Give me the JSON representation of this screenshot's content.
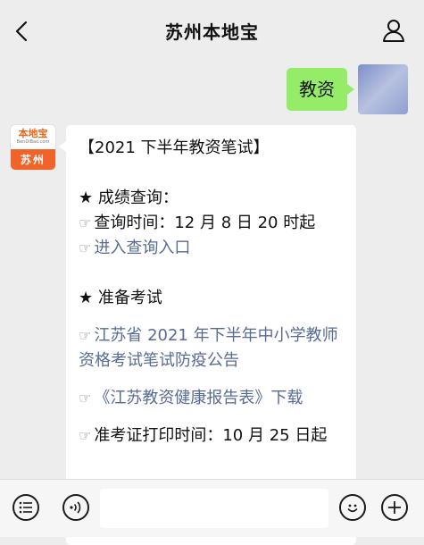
{
  "header": {
    "title": "苏州本地宝"
  },
  "messages": {
    "outgoing": {
      "text": "教资"
    },
    "incoming": {
      "logo_name": "本地宝",
      "logo_sub": "BenDiBao.com",
      "logo_city": "苏州",
      "lines": {
        "heading": "【2021 下半年教资笔试】",
        "score_title": "★ 成绩查询：",
        "query_time": "查询时间：12 月 8 日 20 时起",
        "query_link": "进入查询入口",
        "prep_title": "★ 准备考试",
        "notice_link": "江苏省 2021 年下半年中小学教师资格考试笔试防疫公告",
        "health_link": "《江苏教资健康报告表》下载",
        "admit_time": "准考证打印时间：10 月 25 日起"
      },
      "bullet_icon": "pointing-hand-icon",
      "hand_glyph": "☞"
    }
  },
  "input_bar": {
    "icons": [
      "list-icon",
      "voice-icon",
      "emoji-icon",
      "plus-icon"
    ],
    "placeholder": ""
  },
  "colors": {
    "background": "#ededed",
    "outgoing_bubble": "#95ec69",
    "link": "#576b95",
    "logo_orange": "#f0642a"
  }
}
